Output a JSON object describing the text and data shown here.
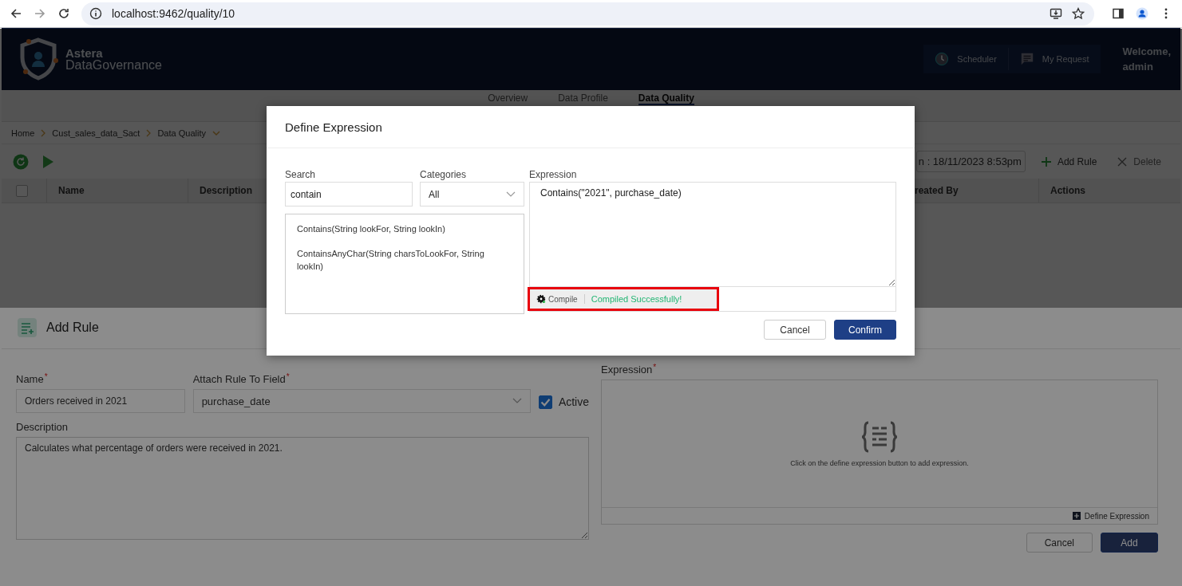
{
  "browser": {
    "url": "localhost:9462/quality/10"
  },
  "header": {
    "brand_line1": "Astera",
    "brand_line2": "DataGovernance",
    "buttons": [
      {
        "label": "Scheduler",
        "kind": "clock"
      },
      {
        "label": "My Request",
        "kind": "chat"
      }
    ],
    "welcome": "Welcome,",
    "user": "admin"
  },
  "tabs": [
    {
      "label": "Overview",
      "selected": false
    },
    {
      "label": "Data Profile",
      "selected": false
    },
    {
      "label": "Data Quality",
      "selected": true
    }
  ],
  "breadcrumb": [
    "Home",
    "Cust_sales_data_Sact",
    "Data Quality"
  ],
  "toolbar": {
    "last_run": "n : 18/11/2023 8:53pm",
    "add_rule": "Add Rule",
    "delete": "Delete",
    "delete_disabled": true
  },
  "table": {
    "select_all_checked": false,
    "columns": [
      "Name",
      "Description",
      "reated By",
      "Actions"
    ]
  },
  "add_rule": {
    "title": "Add Rule",
    "name_label": "Name",
    "name_mark": "*",
    "field_mark": "*",
    "expression_mark": "*",
    "name_value": "Orders received in 2021",
    "field_label": "Attach Rule To Field",
    "field_value": "purchase_date",
    "active_label": "Active",
    "active_checked": true,
    "description_label": "Description",
    "description_value": "Calculates what percentage of orders were received in 2021.",
    "expression_label": "Expression",
    "expression_hint": "Click on the define expression button to add expression.",
    "define_button": "Define Expression",
    "cancel": "Cancel",
    "add": "Add"
  },
  "dialog": {
    "title": "Define Expression",
    "search_label": "Search",
    "search_value": "contain",
    "categories_label": "Categories",
    "categories_value": "All",
    "functions": [
      "Contains(String lookFor, String lookIn)",
      "ContainsAnyChar(String charsToLookFor, String lookIn)"
    ],
    "expression_label": "Expression",
    "expression_value": "Contains(\"2021\", purchase_date)",
    "compile": "Compile",
    "status": "Compiled Successfully!",
    "highlighted": true,
    "cancel": "Cancel",
    "confirm": "Confirm"
  }
}
